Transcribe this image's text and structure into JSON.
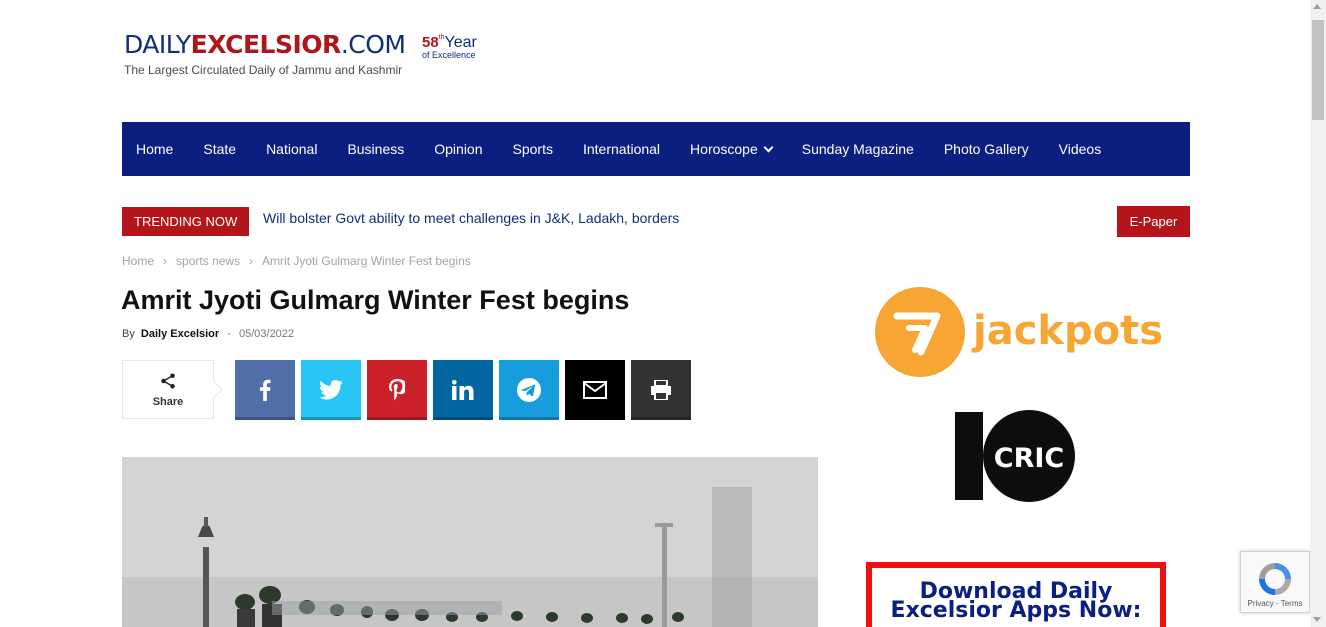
{
  "logo": {
    "part_daily": "DAILY",
    "part_excelsior": "EXCELSIOR",
    "part_com": ".COM",
    "year_num": "58",
    "year_sup": "th",
    "year_word": "Year",
    "year_sub": "of Excellence",
    "tagline": "The Largest Circulated Daily of Jammu and Kashmir",
    "brand_blue": "#0f2f7a",
    "brand_red": "#b0151c"
  },
  "nav": {
    "background": "#0a1f80",
    "items": [
      {
        "label": "Home"
      },
      {
        "label": "State"
      },
      {
        "label": "National"
      },
      {
        "label": "Business"
      },
      {
        "label": "Opinion"
      },
      {
        "label": "Sports"
      },
      {
        "label": "International"
      },
      {
        "label": "Horoscope"
      },
      {
        "label": "Sunday Magazine"
      },
      {
        "label": "Photo Gallery"
      },
      {
        "label": "Videos"
      }
    ]
  },
  "trending": {
    "badge": "TRENDING NOW",
    "headline": "Will bolster Govt ability to meet challenges in J&K, Ladakh, borders",
    "epaper": "E-Paper"
  },
  "breadcrumb": {
    "items": [
      "Home",
      "sports news",
      "Amrit Jyoti Gulmarg Winter Fest begins"
    ],
    "separator": "›"
  },
  "article": {
    "title": "Amrit Jyoti Gulmarg Winter Fest begins",
    "by": "By",
    "author": "Daily Excelsior",
    "date": "05/03/2022"
  },
  "share": {
    "label": "Share",
    "buttons": [
      {
        "icon": "facebook-icon",
        "color": "#516eab"
      },
      {
        "icon": "twitter-icon",
        "color": "#29c5f6"
      },
      {
        "icon": "pinterest-icon",
        "color": "#ca212a"
      },
      {
        "icon": "linkedin-icon",
        "color": "#0266a0"
      },
      {
        "icon": "telegram-icon",
        "color": "#179cde"
      },
      {
        "icon": "email-icon",
        "color": "#000000"
      },
      {
        "icon": "print-icon",
        "color": "#333333"
      }
    ]
  },
  "sidebar": {
    "ad1_text": "jackpots",
    "ad1_color": "#f7a533",
    "ad2_text": "CRIC",
    "download_line1": "Download Daily",
    "download_line2": "Excelsior Apps Now:"
  },
  "recaptcha": {
    "privacy": "Privacy",
    "terms": "Terms"
  }
}
